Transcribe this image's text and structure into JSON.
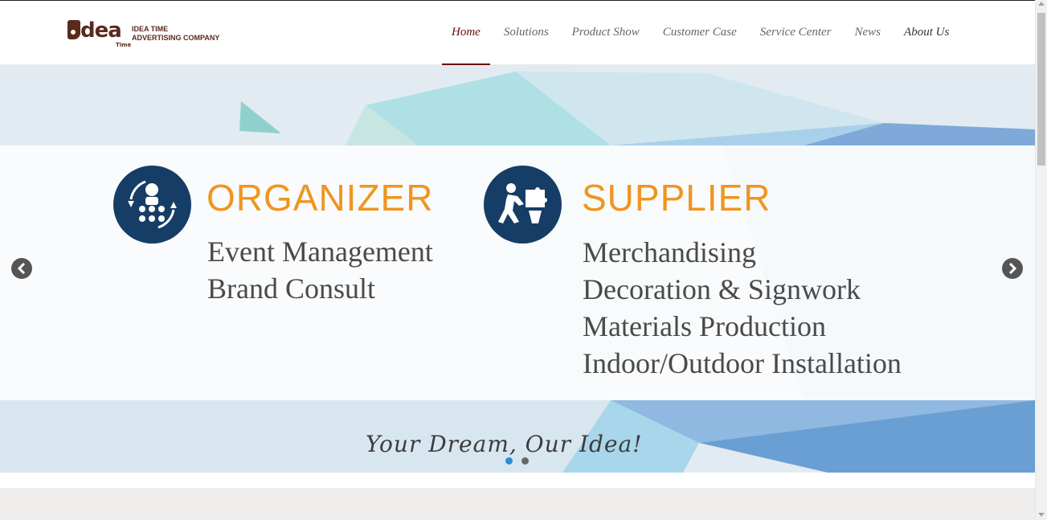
{
  "logo": {
    "mark": "dea",
    "time": "Time",
    "line1": "IDEA TIME",
    "line2": "ADVERTISING COMPANY"
  },
  "nav": {
    "items": [
      {
        "label": "Home",
        "active": true
      },
      {
        "label": "Solutions"
      },
      {
        "label": "Product Show"
      },
      {
        "label": "Customer Case"
      },
      {
        "label": "Service Center"
      },
      {
        "label": "News"
      },
      {
        "label": "About Us"
      }
    ]
  },
  "slide": {
    "organizer": {
      "title": "ORGANIZER",
      "lines": [
        "Event Management",
        "Brand Consult"
      ],
      "icon": "team-cycle-icon"
    },
    "supplier": {
      "title": "SUPPLIER",
      "lines": [
        "Merchandising",
        "Decoration & Signwork",
        "Materials Production",
        "Indoor/Outdoor Installation"
      ],
      "icon": "worker-puzzle-icon"
    },
    "tagline": "Your Dream, Our Idea!"
  },
  "carousel": {
    "prev_icon": "chevron-left-icon",
    "next_icon": "chevron-right-icon",
    "current": 1,
    "total": 2
  },
  "colors": {
    "accent": "#6b0c0c",
    "heading": "#f0951f",
    "icon_bg": "#163d66",
    "dot_active": "#2a8fd4"
  }
}
